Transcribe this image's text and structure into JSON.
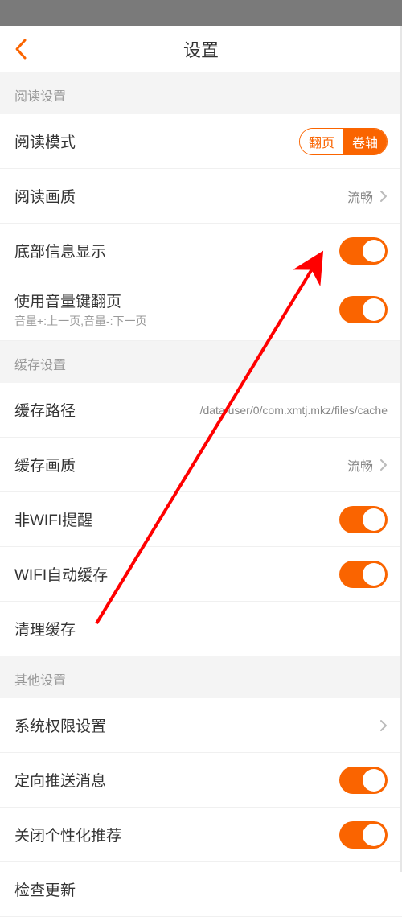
{
  "header": {
    "title": "设置"
  },
  "sections": {
    "reading": {
      "header": "阅读设置",
      "mode": {
        "label": "阅读模式",
        "opt1": "翻页",
        "opt2": "卷轴"
      },
      "quality": {
        "label": "阅读画质",
        "value": "流畅"
      },
      "bottom_info": {
        "label": "底部信息显示"
      },
      "volume_keys": {
        "label": "使用音量键翻页",
        "sublabel": "音量+:上一页,音量-:下一页"
      }
    },
    "cache": {
      "header": "缓存设置",
      "path": {
        "label": "缓存路径",
        "value": "/data/user/0/com.xmtj.mkz/files/cache"
      },
      "quality": {
        "label": "缓存画质",
        "value": "流畅"
      },
      "wifi_remind": {
        "label": "非WIFI提醒"
      },
      "wifi_auto": {
        "label": "WIFI自动缓存"
      },
      "clear": {
        "label": "清理缓存"
      }
    },
    "other": {
      "header": "其他设置",
      "permissions": {
        "label": "系统权限设置"
      },
      "push": {
        "label": "定向推送消息"
      },
      "personalization": {
        "label": "关闭个性化推荐"
      },
      "update": {
        "label": "检查更新"
      }
    }
  },
  "colors": {
    "accent": "#fa6400"
  }
}
